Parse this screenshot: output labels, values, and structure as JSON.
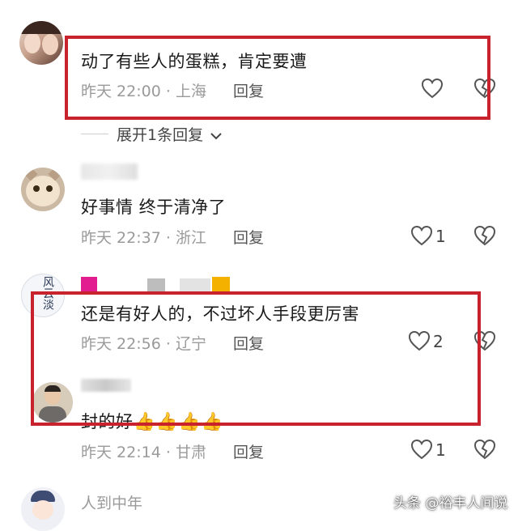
{
  "colors": {
    "highlight": "#c8232c",
    "meta_gray": "#9a9a9a",
    "text": "#1a1a1a"
  },
  "comments": [
    {
      "text": "动了有些人的蛋糕，肯定要遭",
      "time": "昨天 22:00",
      "location": "上海",
      "reply_label": "回复",
      "likes": "",
      "avatar": "two-girls-avatar"
    },
    {
      "text": "好事情 终于清净了",
      "time": "昨天 22:37",
      "location": "浙江",
      "reply_label": "回复",
      "likes": "1",
      "avatar": "cat-avatar"
    },
    {
      "text": "还是有好人的，不过坏人手段更厉害",
      "time": "昨天 22:56",
      "location": "辽宁",
      "reply_label": "回复",
      "likes": "2",
      "avatar": "calligraphy-avatar"
    },
    {
      "text": "封的好",
      "emoji": "👍👍👍👍",
      "time": "昨天 22:14",
      "location": "甘肃",
      "reply_label": "回复",
      "likes": "1",
      "avatar": "man-avatar"
    },
    {
      "username": "人到中年",
      "avatar": "cartoon-girl-avatar"
    }
  ],
  "expand_replies": {
    "label": "展开1条回复"
  },
  "avatar_text": {
    "calligraphy": "风云淡"
  },
  "separator": "·",
  "watermark": "头条 @裕丰人间说"
}
